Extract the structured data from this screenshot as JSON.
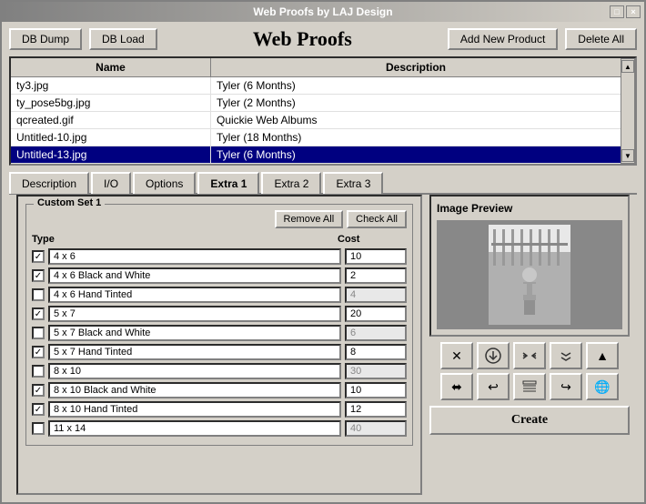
{
  "window": {
    "title": "Web Proofs by LAJ Design",
    "title_buttons": [
      "□",
      "×"
    ]
  },
  "toolbar": {
    "db_dump_label": "DB Dump",
    "db_load_label": "DB Load",
    "app_title": "Web Proofs",
    "add_new_product_label": "Add New Product",
    "delete_all_label": "Delete All"
  },
  "table": {
    "col_name": "Name",
    "col_description": "Description",
    "rows": [
      {
        "name": "ty3.jpg",
        "description": "Tyler (6 Months)",
        "selected": false
      },
      {
        "name": "ty_pose5bg.jpg",
        "description": "Tyler (2 Months)",
        "selected": false
      },
      {
        "name": "qcreated.gif",
        "description": "Quickie Web Albums",
        "selected": false
      },
      {
        "name": "Untitled-10.jpg",
        "description": "Tyler (18 Months)",
        "selected": false
      },
      {
        "name": "Untitled-13.jpg",
        "description": "Tyler (6 Months)",
        "selected": true
      }
    ]
  },
  "tabs": [
    {
      "label": "Description",
      "active": false
    },
    {
      "label": "I/O",
      "active": false
    },
    {
      "label": "Options",
      "active": false
    },
    {
      "label": "Extra 1",
      "active": true
    },
    {
      "label": "Extra 2",
      "active": false
    },
    {
      "label": "Extra 3",
      "active": false
    }
  ],
  "custom_set": {
    "label": "Custom Set 1",
    "remove_all": "Remove All",
    "check_all": "Check All",
    "col_type": "Type",
    "col_cost": "Cost",
    "products": [
      {
        "checked": true,
        "name": "4 x 6",
        "cost": "10",
        "disabled": false
      },
      {
        "checked": true,
        "name": "4 x 6 Black and White",
        "cost": "2",
        "disabled": false
      },
      {
        "checked": false,
        "name": "4 x 6 Hand Tinted",
        "cost": "4",
        "disabled": true
      },
      {
        "checked": true,
        "name": "5 x 7",
        "cost": "20",
        "disabled": false
      },
      {
        "checked": false,
        "name": "5 x 7 Black and White",
        "cost": "6",
        "disabled": true
      },
      {
        "checked": true,
        "name": "5 x 7 Hand Tinted",
        "cost": "8",
        "disabled": false
      },
      {
        "checked": false,
        "name": "8 x 10",
        "cost": "30",
        "disabled": true
      },
      {
        "checked": true,
        "name": "8 x 10 Black and White",
        "cost": "10",
        "disabled": false
      },
      {
        "checked": true,
        "name": "8 x 10 Hand Tinted",
        "cost": "12",
        "disabled": false
      },
      {
        "checked": false,
        "name": "11 x 14",
        "cost": "40",
        "disabled": true
      }
    ]
  },
  "image_preview": {
    "title": "Image Preview"
  },
  "icons": {
    "row1": [
      "✕",
      "⬇",
      "◄►",
      "►◄",
      "▲"
    ],
    "row2": [
      "⬌",
      "↩",
      "☰",
      "↪",
      "🌐"
    ]
  },
  "create_button": "Create"
}
